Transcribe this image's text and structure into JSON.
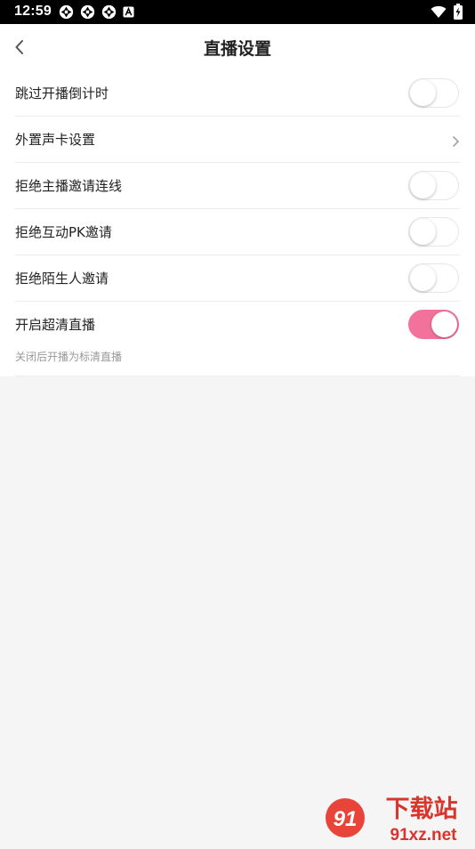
{
  "status_bar": {
    "time": "12:59",
    "left_icons": [
      "aperture-icon",
      "aperture-icon",
      "aperture-icon",
      "a-badge-icon"
    ],
    "right_icons": [
      "wifi-icon",
      "battery-charging-icon"
    ]
  },
  "header": {
    "title": "直播设置"
  },
  "settings": [
    {
      "label": "跳过开播倒计时",
      "control": "toggle",
      "on": false
    },
    {
      "label": "外置声卡设置",
      "control": "chevron"
    },
    {
      "label": "拒绝主播邀请连线",
      "control": "toggle",
      "on": false
    },
    {
      "label": "拒绝互动PK邀请",
      "control": "toggle",
      "on": false
    },
    {
      "label": "拒绝陌生人邀请",
      "control": "toggle",
      "on": false
    },
    {
      "label": "开启超清直播",
      "control": "toggle",
      "on": true
    }
  ],
  "hint": "关闭后开播为标清直播",
  "watermark": {
    "text_top": "下载站",
    "text_bottom": "91xz.net",
    "logo_text": "91"
  },
  "colors": {
    "accent": "#f2729b",
    "background": "#f5f5f5",
    "card": "#ffffff"
  }
}
